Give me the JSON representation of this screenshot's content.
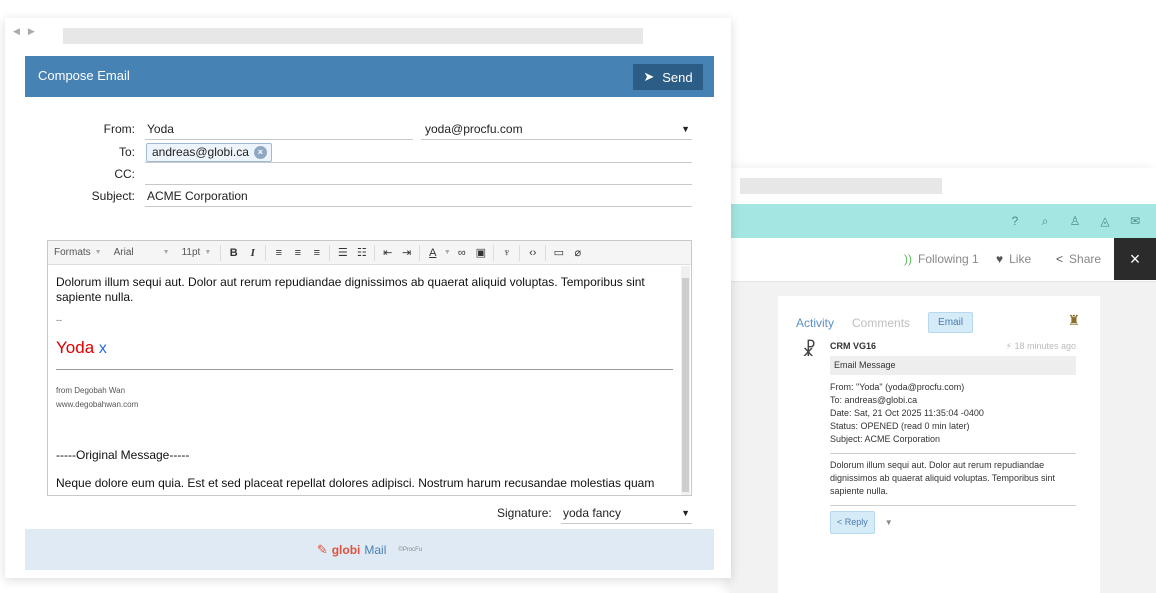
{
  "crm": {
    "header_icons": [
      "help-icon",
      "search-icon",
      "user-icon",
      "bell-icon",
      "chat-icon"
    ],
    "actions": {
      "following": "Following 1",
      "like": "Like",
      "share": "Share",
      "close": "×"
    },
    "tabs": {
      "activity": "Activity",
      "comments": "Comments",
      "email": "Email"
    },
    "entry": {
      "source": "CRM VG16",
      "time": "18 minutes ago",
      "type": "Email Message",
      "from": "From: \"Yoda\" (yoda@procfu.com)",
      "to": "To: andreas@globi.ca",
      "date": "Date: Sat, 21 Oct 2025 11:35:04 -0400",
      "status": "Status: OPENED (read 0 min later)",
      "subject": "Subject: ACME Corporation",
      "body": "Dolorum illum sequi aut. Dolor aut rerum repudiandae dignissimos ab quaerat aliquid voluptas. Temporibus sint sapiente nulla.",
      "reply_label": "< Reply"
    }
  },
  "compose": {
    "title": "Compose Email",
    "send_label": "Send",
    "from_label": "From:",
    "from_name": "Yoda",
    "from_email": "yoda@procfu.com",
    "to_label": "To:",
    "to_recipients": [
      "andreas@globi.ca"
    ],
    "cc_label": "CC:",
    "cc_value": "",
    "subject_label": "Subject:",
    "subject_value": "ACME Corporation",
    "toolbar": {
      "formats": "Formats",
      "font": "Arial",
      "size": "11pt"
    },
    "body": {
      "text": "Dolorum illum sequi aut. Dolor aut rerum repudiandae dignissimos ab quaerat aliquid voluptas. Temporibus sint sapiente nulla.",
      "sig_dash": "--",
      "sig_name": "Yoda",
      "sig_x": "x",
      "sig_from": "from Degobah Wan",
      "sig_site": "www.degobahwan.com",
      "original_header": "-----Original Message-----",
      "original_body": "Neque dolore eum quia. Est et sed placeat repellat dolores adipisci. Nostrum harum recusandae molestias quam"
    },
    "signature_label": "Signature:",
    "signature_value": "yoda fancy",
    "footer": {
      "logo_globi": "globi",
      "logo_mail": "Mail",
      "logo_procfu": "©ProcFu"
    }
  }
}
